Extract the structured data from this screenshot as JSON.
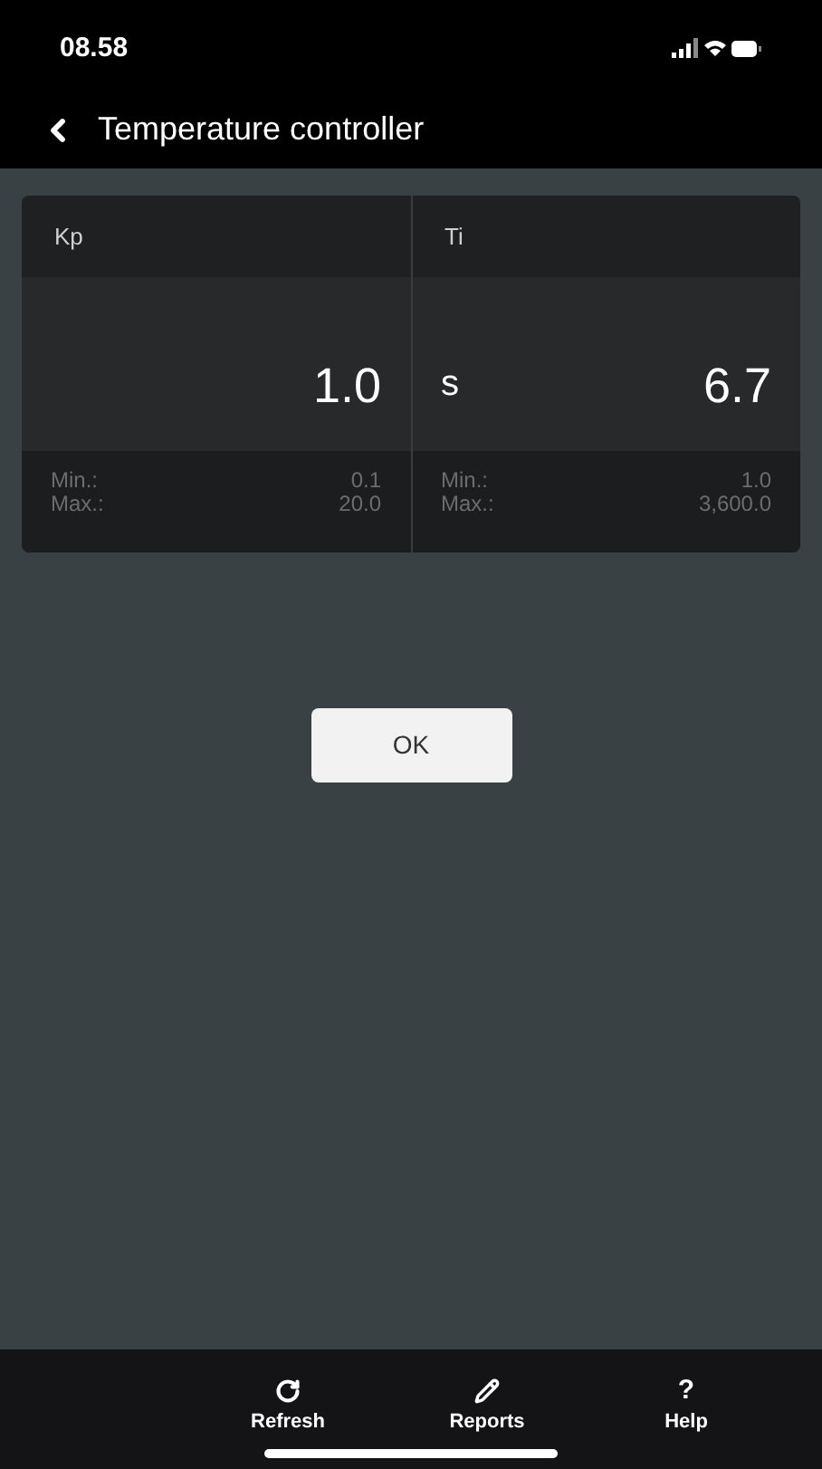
{
  "status_bar": {
    "time": "08.58"
  },
  "nav": {
    "title": "Temperature controller"
  },
  "parameters": [
    {
      "label": "Kp",
      "value": "1.0",
      "min_label": "Min.:",
      "min": "0.1",
      "max_label": "Max.:",
      "max": "20.0"
    },
    {
      "label": "Ti",
      "unit": "s",
      "value": "6.7",
      "min_label": "Min.:",
      "min": "1.0",
      "max_label": "Max.:",
      "max": "3,600.0"
    }
  ],
  "ok_button": "OK",
  "tab_bar": [
    {
      "kind": "refresh",
      "label": "Refresh"
    },
    {
      "kind": "reports",
      "label": "Reports"
    },
    {
      "kind": "help",
      "glyph": "?",
      "label": "Help"
    }
  ]
}
